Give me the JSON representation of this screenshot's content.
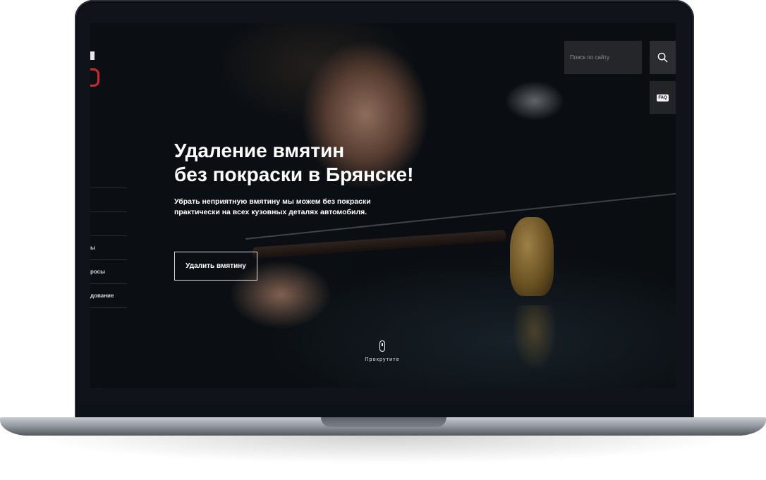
{
  "search": {
    "placeholder": "Поиск по сайту"
  },
  "faq": {
    "label": "FAQ"
  },
  "side_menu": {
    "items": [
      {
        "label": ""
      },
      {
        "label": ""
      },
      {
        "label": "ы"
      },
      {
        "label": "росы"
      },
      {
        "label": "дование"
      }
    ]
  },
  "hero": {
    "title_line1": "Удаление вмятин",
    "title_line2": "без покраски в Брянске!",
    "subtitle": "Убрать неприятную вмятину мы можем без покраски практически на всех кузовных деталях автомобиля.",
    "cta_label": "Удалить вмятину"
  },
  "scroll_hint": {
    "label": "Прокрутите"
  },
  "colors": {
    "accent": "#d3272f",
    "screen_bg": "#0f1013"
  }
}
